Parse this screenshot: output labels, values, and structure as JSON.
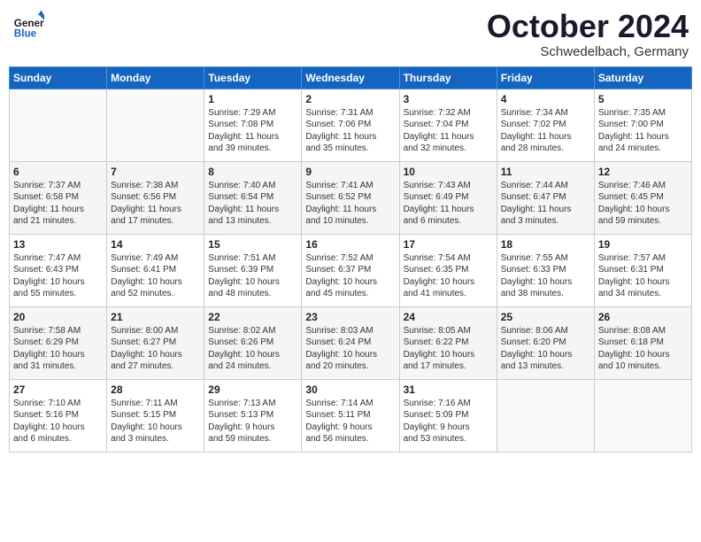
{
  "header": {
    "logo_text_general": "General",
    "logo_text_blue": "Blue",
    "month": "October 2024",
    "location": "Schwedelbach, Germany"
  },
  "calendar": {
    "days_of_week": [
      "Sunday",
      "Monday",
      "Tuesday",
      "Wednesday",
      "Thursday",
      "Friday",
      "Saturday"
    ],
    "weeks": [
      [
        {
          "day": "",
          "info": ""
        },
        {
          "day": "",
          "info": ""
        },
        {
          "day": "1",
          "info": "Sunrise: 7:29 AM\nSunset: 7:08 PM\nDaylight: 11 hours\nand 39 minutes."
        },
        {
          "day": "2",
          "info": "Sunrise: 7:31 AM\nSunset: 7:06 PM\nDaylight: 11 hours\nand 35 minutes."
        },
        {
          "day": "3",
          "info": "Sunrise: 7:32 AM\nSunset: 7:04 PM\nDaylight: 11 hours\nand 32 minutes."
        },
        {
          "day": "4",
          "info": "Sunrise: 7:34 AM\nSunset: 7:02 PM\nDaylight: 11 hours\nand 28 minutes."
        },
        {
          "day": "5",
          "info": "Sunrise: 7:35 AM\nSunset: 7:00 PM\nDaylight: 11 hours\nand 24 minutes."
        }
      ],
      [
        {
          "day": "6",
          "info": "Sunrise: 7:37 AM\nSunset: 6:58 PM\nDaylight: 11 hours\nand 21 minutes."
        },
        {
          "day": "7",
          "info": "Sunrise: 7:38 AM\nSunset: 6:56 PM\nDaylight: 11 hours\nand 17 minutes."
        },
        {
          "day": "8",
          "info": "Sunrise: 7:40 AM\nSunset: 6:54 PM\nDaylight: 11 hours\nand 13 minutes."
        },
        {
          "day": "9",
          "info": "Sunrise: 7:41 AM\nSunset: 6:52 PM\nDaylight: 11 hours\nand 10 minutes."
        },
        {
          "day": "10",
          "info": "Sunrise: 7:43 AM\nSunset: 6:49 PM\nDaylight: 11 hours\nand 6 minutes."
        },
        {
          "day": "11",
          "info": "Sunrise: 7:44 AM\nSunset: 6:47 PM\nDaylight: 11 hours\nand 3 minutes."
        },
        {
          "day": "12",
          "info": "Sunrise: 7:46 AM\nSunset: 6:45 PM\nDaylight: 10 hours\nand 59 minutes."
        }
      ],
      [
        {
          "day": "13",
          "info": "Sunrise: 7:47 AM\nSunset: 6:43 PM\nDaylight: 10 hours\nand 55 minutes."
        },
        {
          "day": "14",
          "info": "Sunrise: 7:49 AM\nSunset: 6:41 PM\nDaylight: 10 hours\nand 52 minutes."
        },
        {
          "day": "15",
          "info": "Sunrise: 7:51 AM\nSunset: 6:39 PM\nDaylight: 10 hours\nand 48 minutes."
        },
        {
          "day": "16",
          "info": "Sunrise: 7:52 AM\nSunset: 6:37 PM\nDaylight: 10 hours\nand 45 minutes."
        },
        {
          "day": "17",
          "info": "Sunrise: 7:54 AM\nSunset: 6:35 PM\nDaylight: 10 hours\nand 41 minutes."
        },
        {
          "day": "18",
          "info": "Sunrise: 7:55 AM\nSunset: 6:33 PM\nDaylight: 10 hours\nand 38 minutes."
        },
        {
          "day": "19",
          "info": "Sunrise: 7:57 AM\nSunset: 6:31 PM\nDaylight: 10 hours\nand 34 minutes."
        }
      ],
      [
        {
          "day": "20",
          "info": "Sunrise: 7:58 AM\nSunset: 6:29 PM\nDaylight: 10 hours\nand 31 minutes."
        },
        {
          "day": "21",
          "info": "Sunrise: 8:00 AM\nSunset: 6:27 PM\nDaylight: 10 hours\nand 27 minutes."
        },
        {
          "day": "22",
          "info": "Sunrise: 8:02 AM\nSunset: 6:26 PM\nDaylight: 10 hours\nand 24 minutes."
        },
        {
          "day": "23",
          "info": "Sunrise: 8:03 AM\nSunset: 6:24 PM\nDaylight: 10 hours\nand 20 minutes."
        },
        {
          "day": "24",
          "info": "Sunrise: 8:05 AM\nSunset: 6:22 PM\nDaylight: 10 hours\nand 17 minutes."
        },
        {
          "day": "25",
          "info": "Sunrise: 8:06 AM\nSunset: 6:20 PM\nDaylight: 10 hours\nand 13 minutes."
        },
        {
          "day": "26",
          "info": "Sunrise: 8:08 AM\nSunset: 6:18 PM\nDaylight: 10 hours\nand 10 minutes."
        }
      ],
      [
        {
          "day": "27",
          "info": "Sunrise: 7:10 AM\nSunset: 5:16 PM\nDaylight: 10 hours\nand 6 minutes."
        },
        {
          "day": "28",
          "info": "Sunrise: 7:11 AM\nSunset: 5:15 PM\nDaylight: 10 hours\nand 3 minutes."
        },
        {
          "day": "29",
          "info": "Sunrise: 7:13 AM\nSunset: 5:13 PM\nDaylight: 9 hours\nand 59 minutes."
        },
        {
          "day": "30",
          "info": "Sunrise: 7:14 AM\nSunset: 5:11 PM\nDaylight: 9 hours\nand 56 minutes."
        },
        {
          "day": "31",
          "info": "Sunrise: 7:16 AM\nSunset: 5:09 PM\nDaylight: 9 hours\nand 53 minutes."
        },
        {
          "day": "",
          "info": ""
        },
        {
          "day": "",
          "info": ""
        }
      ]
    ]
  }
}
